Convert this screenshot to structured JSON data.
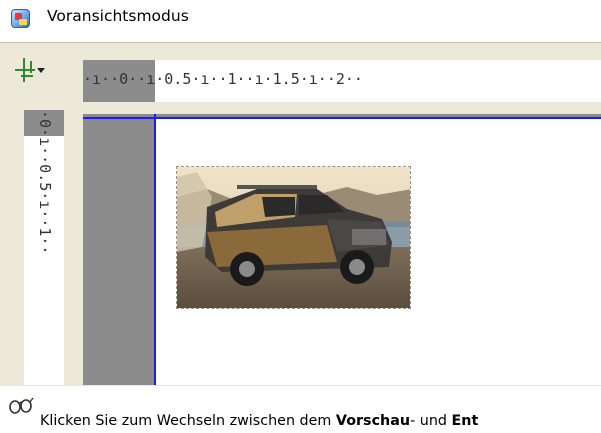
{
  "window": {
    "title": "Voransichtsmodus",
    "app_icon": "image-app-icon"
  },
  "toolbar": {
    "crop_tool_icon": "crop-icon",
    "dropdown_icon": "chevron-down-icon"
  },
  "rulers": {
    "horizontal_labels": "·ı··0··ı·0.5·ı··1··ı·1.5·ı··2··",
    "vertical_labels": "·0·ı··0.5·ı··1··"
  },
  "canvas": {
    "image_description_icon": "car-photo"
  },
  "hint": {
    "icon": "glasses-icon",
    "text_before": "Klicken Sie zum Wechseln zwischen dem ",
    "bold_1": "Vorschau",
    "text_middle": "- und ",
    "bold_2": "Ent"
  },
  "colors": {
    "guide_line": "#1a1aff",
    "ruler_gray": "#8c8c8c",
    "frame": "#ece9d8"
  }
}
